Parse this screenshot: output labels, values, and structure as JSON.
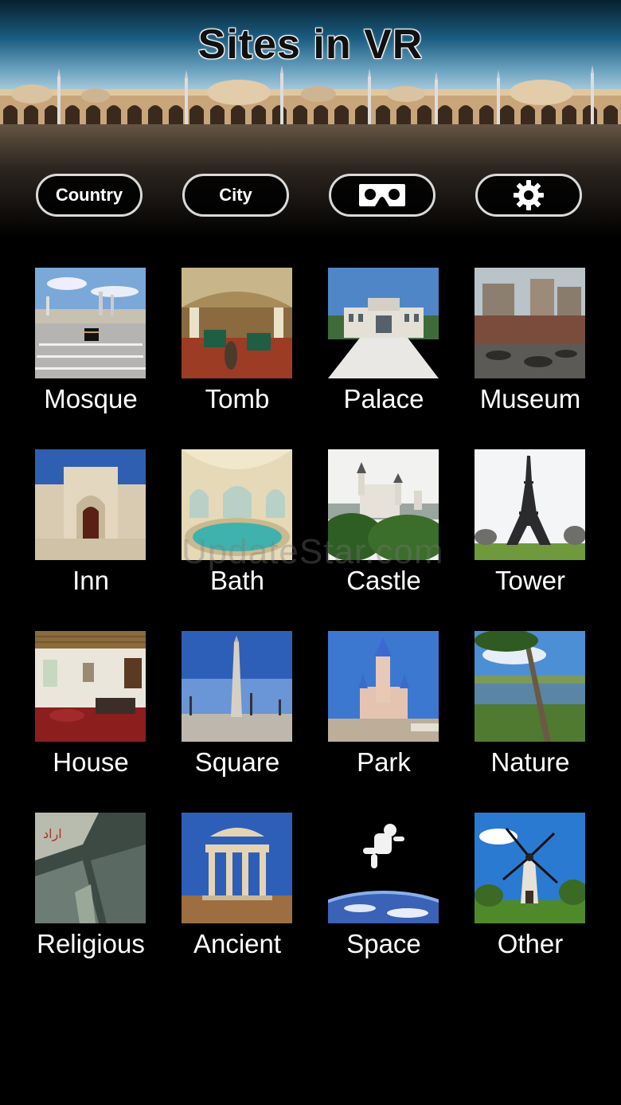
{
  "app": {
    "title": "Sites in VR"
  },
  "toolbar": {
    "country_label": "Country",
    "city_label": "City",
    "vr_icon": "vr-headset-icon",
    "settings_icon": "gear-icon"
  },
  "categories": [
    {
      "label": "Mosque"
    },
    {
      "label": "Tomb"
    },
    {
      "label": "Palace"
    },
    {
      "label": "Museum"
    },
    {
      "label": "Inn"
    },
    {
      "label": "Bath"
    },
    {
      "label": "Castle"
    },
    {
      "label": "Tower"
    },
    {
      "label": "House"
    },
    {
      "label": "Square"
    },
    {
      "label": "Park"
    },
    {
      "label": "Nature"
    },
    {
      "label": "Religious"
    },
    {
      "label": "Ancient"
    },
    {
      "label": "Space"
    },
    {
      "label": "Other"
    }
  ],
  "watermark": "UpdateStar.com",
  "colors": {
    "background": "#000000",
    "button_border": "#d9d9d9",
    "text": "#ffffff"
  }
}
